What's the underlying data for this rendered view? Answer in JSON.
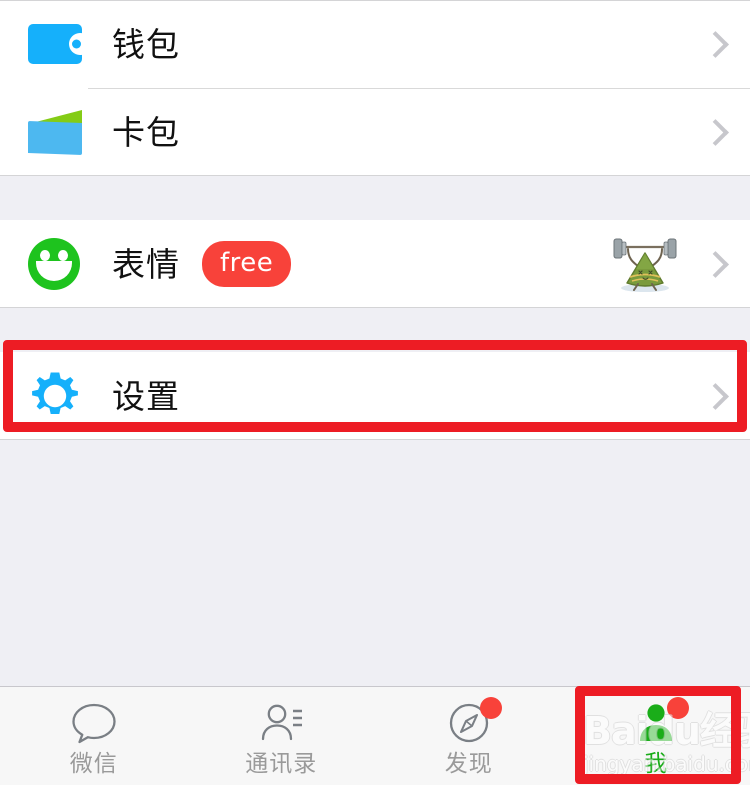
{
  "app": {
    "name": "WeChat",
    "screen": "Me"
  },
  "colors": {
    "accent_blue": "#15B0FB",
    "accent_green": "#1AAD19",
    "badge_red": "#F8423A",
    "annotation_red": "#ED1C24",
    "page_background": "#EFEFF4",
    "row_background": "#FFFFFF",
    "tabbar_background": "#F7F7F7",
    "label_gray": "#9A9A9A",
    "chevron_gray": "#C7C7CC"
  },
  "list_groups": [
    {
      "id": "wallet-group",
      "rows": [
        {
          "id": "wallet",
          "label": "钱包",
          "icon": "wallet-icon",
          "chevron": "chevron-right-icon"
        },
        {
          "id": "card-package",
          "label": "卡包",
          "icon": "card-package-icon",
          "chevron": "chevron-right-icon"
        }
      ]
    },
    {
      "id": "sticker-group",
      "rows": [
        {
          "id": "emoji",
          "label": "表情",
          "icon": "smiley-icon",
          "badge": "free",
          "thumbnail": "zongzi-weightlifter-sticker",
          "chevron": "chevron-right-icon"
        }
      ]
    },
    {
      "id": "settings-group",
      "highlighted": true,
      "rows": [
        {
          "id": "settings",
          "label": "设置",
          "icon": "gear-icon",
          "chevron": "chevron-right-icon"
        }
      ]
    }
  ],
  "annotations": [
    {
      "id": "settings-highlight",
      "target": "设置",
      "color": "#ED1C24"
    },
    {
      "id": "me-tab-highlight",
      "target": "我",
      "color": "#ED1C24"
    }
  ],
  "tabbar": {
    "tabs": [
      {
        "id": "chats",
        "label": "微信",
        "icon": "speech-bubble-icon",
        "active": false,
        "dot": false
      },
      {
        "id": "contacts",
        "label": "通讯录",
        "icon": "contacts-person-icon",
        "active": false,
        "dot": false
      },
      {
        "id": "discover",
        "label": "发现",
        "icon": "compass-icon",
        "active": false,
        "dot": true
      },
      {
        "id": "me",
        "label": "我",
        "icon": "person-icon",
        "active": true,
        "dot": true
      }
    ]
  },
  "watermark": {
    "main": "Baidu经验",
    "sub": "jingyan.baidu.com"
  }
}
